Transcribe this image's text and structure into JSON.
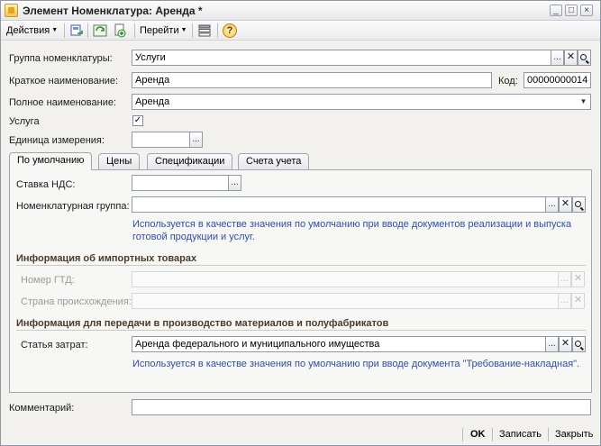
{
  "window": {
    "title": "Элемент Номенклатура: Аренда *",
    "minimize": "_",
    "maximize": "□",
    "close": "×"
  },
  "toolbar": {
    "actions_label": "Действия",
    "goto_label": "Перейти",
    "help_glyph": "?"
  },
  "form": {
    "group_label": "Группа номенклатуры:",
    "group_value": "Услуги",
    "short_name_label": "Краткое наименование:",
    "short_name_value": "Аренда",
    "code_label": "Код:",
    "code_value": "00000000014",
    "full_name_label": "Полное наименование:",
    "full_name_value": "Аренда",
    "service_label": "Услуга",
    "service_checked": "✓",
    "unit_label": "Единица измерения:",
    "unit_value": "",
    "comment_label": "Комментарий:",
    "comment_value": ""
  },
  "buttons": {
    "select": "...",
    "clear": "✕"
  },
  "tabs": [
    {
      "label": "По умолчанию",
      "active": true
    },
    {
      "label": "Цены",
      "active": false
    },
    {
      "label": "Спецификации",
      "active": false
    },
    {
      "label": "Счета учета",
      "active": false
    }
  ],
  "defaults_tab": {
    "vat_label": "Ставка НДС:",
    "vat_value": "",
    "item_group_label": "Номенклатурная группа:",
    "item_group_value": "",
    "item_group_hint": "Используется в качестве значения по умолчанию при вводе документов  реализации и выпуска готовой продукции и услуг.",
    "import_section_title": "Информация об импортных товарах",
    "gtd_label": "Номер ГТД:",
    "gtd_value": "",
    "country_label": "Страна происхождения:",
    "country_value": "",
    "production_section_title": "Информация для передачи в производство материалов и полуфабрикатов",
    "cost_item_label": "Статья затрат:",
    "cost_item_value": "Аренда федерального и муниципального имущества",
    "cost_item_hint": "Используется в качестве значения по умолчанию при вводе документа \"Требование-накладная\"."
  },
  "footer": {
    "ok_label": "OK",
    "save_label": "Записать",
    "close_label": "Закрыть"
  },
  "colors": {
    "hint_text": "#2e4fa3",
    "section_title": "#4b3a2a",
    "window_bg": "#f2f1ed"
  }
}
